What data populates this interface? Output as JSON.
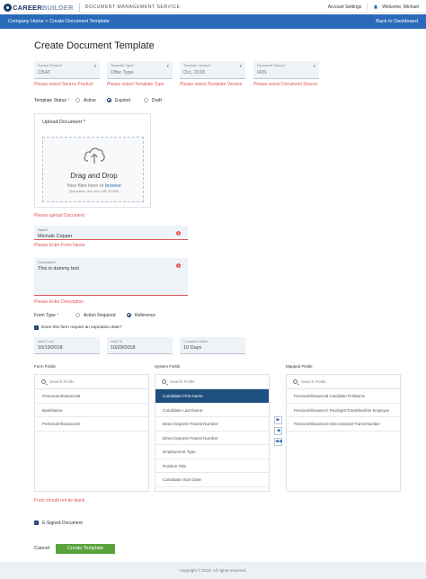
{
  "header": {
    "brand_main": "CAREER",
    "brand_light": "BUILDER",
    "service": "DOCUMENT MANAGEMENT SERVICE",
    "account_settings": "Account Settings",
    "welcome": "Welcome, Michael"
  },
  "subheader": {
    "breadcrumb": "Company Home > Create Document Template",
    "back": "Back to Dashboard"
  },
  "page_title": "Create Document Template",
  "selects": [
    {
      "label": "Source Product*",
      "value": "CBAT",
      "error": "Please select Source Product"
    },
    {
      "label": "Template Type*",
      "value": "Offer Type",
      "error": "Please select Template Type"
    },
    {
      "label": "Template Version*",
      "value": "Oct, 2018",
      "error": "Please select Template Version"
    },
    {
      "label": "Document Source*",
      "value": "IRIS",
      "error": "Please select Document Source"
    }
  ],
  "template_status": {
    "label": "Template Status",
    "required_mark": "*",
    "options": [
      "Active",
      "Expired",
      "Draft"
    ],
    "selected": "Expired"
  },
  "upload": {
    "title": "Upload Document",
    "required_mark": "*",
    "drag": "Drag and Drop",
    "files_prefix": "Your files here or",
    "browse": "browse",
    "accepted": "(Accepted: .doc and .pdf; 20 MB)",
    "error": "Please upload Document"
  },
  "name_field": {
    "label": "Name*",
    "value": "Michale Copper",
    "error": "Please Enter Form Name"
  },
  "description_field": {
    "label": "Description*",
    "value": "This is dummy text",
    "error": "Please Enter Description"
  },
  "form_type": {
    "label": "Form Type",
    "required_mark": "*",
    "options": [
      "Action Required",
      "Reference"
    ],
    "selected": "Reference"
  },
  "expiration": {
    "checkbox_label": "Does this form require an expiration date?",
    "valid_from_label": "Valid From",
    "valid_from": "10/19/2018",
    "valid_to_label": "Valid To",
    "valid_to": "10/29/2018",
    "complete_within_label": "Complete within",
    "complete_within": "10 Days"
  },
  "form_fields": {
    "header": "Form Fields",
    "search_placeholder": "Search Fields",
    "items": [
      "PersonalAllowanceB",
      "BankName",
      "PersonalAllowanceD"
    ],
    "error": "Form should not be blank"
  },
  "system_fields": {
    "header": "System Fields",
    "search_placeholder": "Search Fields",
    "items": [
      "Candidate First Name",
      "Candidate Last Name",
      "Direct Deposit Transit Number",
      "Direct Deposit Transit Number",
      "Employment Type",
      "Position Title",
      "Candidate Start Date"
    ],
    "selected_index": 0
  },
  "mapped_fields": {
    "header": "Mapped Fields",
    "search_placeholder": "Search Fields",
    "items": [
      "PersonalAllowanceB Candidate FirstName",
      "PersonalAllowanceC RoutingOrTransitNumber Employee",
      "PersonalAllowanceD Direct Deposit Transit Number"
    ]
  },
  "transfer_buttons": [
    "▶",
    "◀",
    "◀◀"
  ],
  "esigned": {
    "label": "E-Signed Document"
  },
  "actions": {
    "cancel": "Cancel",
    "create": "Create Template"
  },
  "footer": "Copyright © 2018. All rights reserved.",
  "colors": {
    "primary_blue": "#2a6ab8",
    "navy": "#1a3a6b",
    "error_red": "#e05555",
    "create_green": "#5aa33c",
    "selected_row": "#1f4f7e"
  },
  "icons": {
    "upload": "cloud-upload-icon",
    "search": "search-icon",
    "bell": "bell-icon",
    "warning": "alert-icon"
  }
}
